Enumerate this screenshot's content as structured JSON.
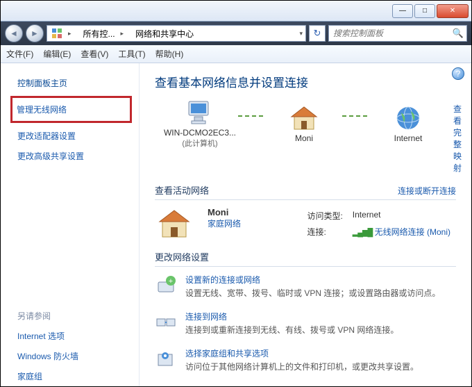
{
  "window": {
    "minimize": "—",
    "maximize": "□",
    "close": "✕"
  },
  "nav": {
    "back": "◄",
    "forward": "►",
    "crumb1": "所有控...",
    "crumb2": "网络和共享中心",
    "refresh": "↻",
    "search_placeholder": "搜索控制面板"
  },
  "menu": {
    "file": "文件(F)",
    "edit": "编辑(E)",
    "view": "查看(V)",
    "tools": "工具(T)",
    "help": "帮助(H)"
  },
  "sidebar": {
    "home": "控制面板主页",
    "wireless": "管理无线网络",
    "adapter": "更改适配器设置",
    "advanced": "更改高级共享设置",
    "seealso": "另请参阅",
    "internet_options": "Internet 选项",
    "firewall": "Windows 防火墙",
    "homegroup": "家庭组"
  },
  "main": {
    "title": "查看基本网络信息并设置连接",
    "full_map_link": "查看完整映射",
    "map": {
      "pc": "WIN-DCMO2EC3...",
      "pc_sub": "(此计算机)",
      "router": "Moni",
      "internet": "Internet"
    },
    "active_head": "查看活动网络",
    "active_link": "连接或断开连接",
    "active": {
      "name": "Moni",
      "type": "家庭网络",
      "access_label": "访问类型:",
      "access_value": "Internet",
      "conn_label": "连接:",
      "conn_value": "无线网络连接 (Moni)"
    },
    "settings_head": "更改网络设置",
    "items": [
      {
        "title": "设置新的连接或网络",
        "desc": "设置无线、宽带、拨号、临时或 VPN 连接；或设置路由器或访问点。"
      },
      {
        "title": "连接到网络",
        "desc": "连接到或重新连接到无线、有线、拨号或 VPN 网络连接。"
      },
      {
        "title": "选择家庭组和共享选项",
        "desc": "访问位于其他网络计算机上的文件和打印机，或更改共享设置。"
      }
    ]
  }
}
